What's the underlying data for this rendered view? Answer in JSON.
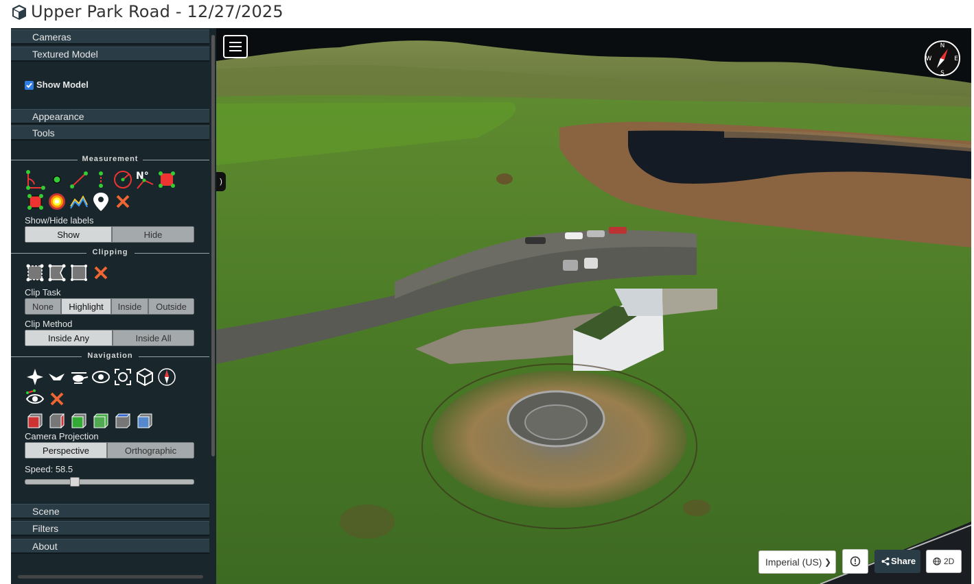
{
  "window": {
    "title": "Upper Park Road - 12/27/2025"
  },
  "sidebar": {
    "cameras": "Cameras",
    "textured_model": "Textured Model",
    "show_model": {
      "label": "Show Model",
      "checked": true
    },
    "appearance": "Appearance",
    "tools": "Tools",
    "measurement": {
      "title": "Measurement",
      "icons": [
        "angle-icon",
        "point-icon",
        "distance-icon",
        "height-icon",
        "circle-icon",
        "azimuth-icon",
        "area-icon",
        "volume-icon",
        "heatmap-icon",
        "profile-icon",
        "annotation-icon",
        "remove-measurements-icon"
      ],
      "labels_title": "Show/Hide labels",
      "show": "Show",
      "hide": "Hide"
    },
    "clipping": {
      "title": "Clipping",
      "clip_task_label": "Clip Task",
      "tasks": [
        "None",
        "Highlight",
        "Inside",
        "Outside"
      ],
      "active_task": "Highlight",
      "clip_method_label": "Clip Method",
      "methods": [
        "Inside Any",
        "Inside All"
      ],
      "active_method": "Inside Any"
    },
    "navigation": {
      "title": "Navigation",
      "camera_projection_label": "Camera Projection",
      "projections": [
        "Perspective",
        "Orthographic"
      ],
      "active_projection": "Perspective",
      "speed_label": "Speed: 58.5",
      "speed_fraction": 0.28
    },
    "scene": "Scene",
    "filters": "Filters",
    "about": "About"
  },
  "viewer": {
    "units": "Imperial (US)",
    "share": "Share",
    "twod": "2D",
    "colors": {
      "accent": "#2a3c45",
      "grass": "#4a7a2a",
      "water": "#8a6440"
    }
  }
}
